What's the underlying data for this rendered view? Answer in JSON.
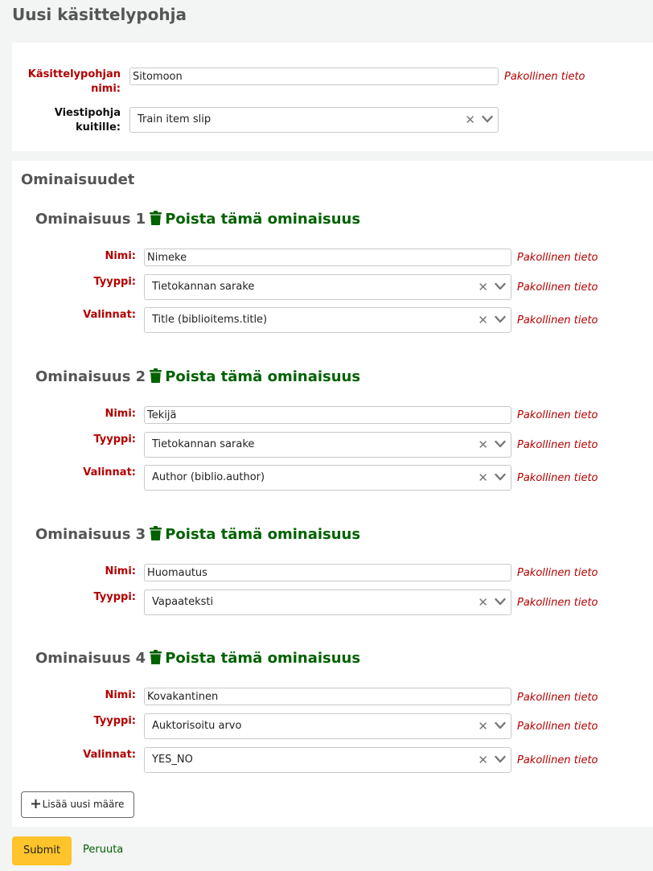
{
  "page": {
    "title": "Uusi käsittelypohja"
  },
  "template": {
    "name_label": "Käsittelypohjan nimi:",
    "name_value": "Sitomoon",
    "required_note": "Pakollinen tieto",
    "slip_label": "Viestipohja kuitille:",
    "slip_value": "Train item slip"
  },
  "properties_section": {
    "title": "Ominaisuudet",
    "delete_label": "Poista tämä ominaisuus",
    "name_label": "Nimi:",
    "type_label": "Tyyppi:",
    "options_label": "Valinnat:",
    "required_note": "Pakollinen tieto",
    "items": [
      {
        "title": "Ominaisuus 1",
        "name": "Nimeke",
        "type": "Tietokannan sarake",
        "options": "Title (biblioitems.title)"
      },
      {
        "title": "Ominaisuus 2",
        "name": "Tekijä",
        "type": "Tietokannan sarake",
        "options": "Author (biblio.author)"
      },
      {
        "title": "Ominaisuus 3",
        "name": "Huomautus",
        "type": "Vapaateksti"
      },
      {
        "title": "Ominaisuus 4",
        "name": "Kovakantinen",
        "type": "Auktorisoitu arvo",
        "options": "YES_NO"
      }
    ],
    "add_button_label": "Lisää uusi määre"
  },
  "actions": {
    "submit_label": "Submit",
    "cancel_label": "Peruuta"
  },
  "icons": {
    "trash": "trash-icon",
    "plus": "plus-icon",
    "clear": "clear-icon",
    "chevron": "chevron-down-icon"
  },
  "colors": {
    "required": "#b30000",
    "link": "#006100",
    "submit": "#ffc32b"
  }
}
